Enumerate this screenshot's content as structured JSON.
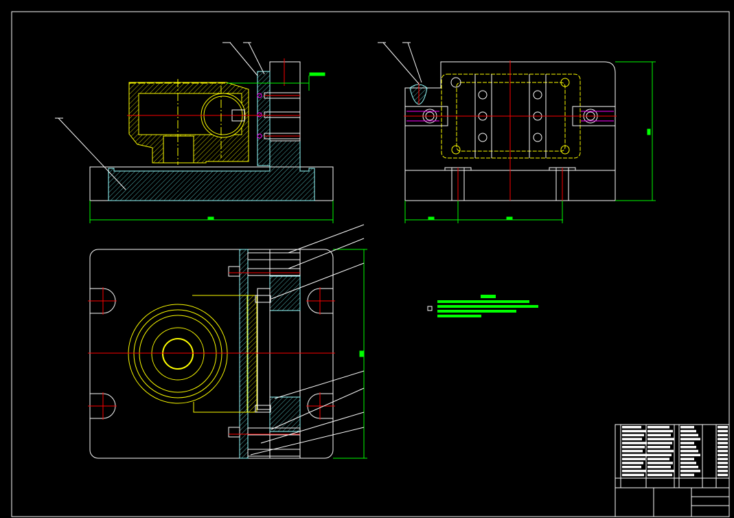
{
  "drawing": {
    "kind": "fixture assembly drawing",
    "background": "#000000",
    "colors": {
      "outline": "#ffffff",
      "workpiece": "#ffff00",
      "hatch": "#66e0e0",
      "centerline": "#ff0000",
      "dimension": "#00ff00",
      "fastener": "#ff00ff"
    },
    "views": [
      "front-section",
      "side-view",
      "top-view"
    ],
    "technical_notes": {
      "line_count": 4
    },
    "title_block": {
      "rows": 13
    }
  }
}
